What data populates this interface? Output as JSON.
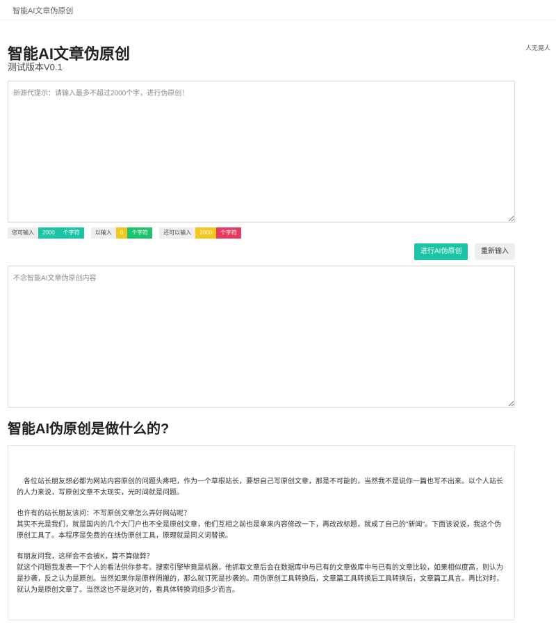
{
  "nav": {
    "brand": "智能AI文章伪原创"
  },
  "side_note": "人无竟人",
  "header": {
    "title": "智能AI文章伪原创",
    "subtitle": "测试版本V0.1"
  },
  "input": {
    "placeholder": "新源代提示：请输入最多不超过2000个字，进行伪原创！"
  },
  "counters": [
    {
      "label": "您可输入",
      "value": "2000",
      "unit": "个字符",
      "value_color": "#1bc4a4",
      "unit_color": "#1bc4a4"
    },
    {
      "label": "以输入",
      "value": "0",
      "unit": "个字符",
      "value_color": "#f5c61b",
      "unit_color": "#1bc46a"
    },
    {
      "label": "还可以输入",
      "value": "2000",
      "unit": "个字符",
      "value_color": "#f5c61b",
      "unit_color": "#e8395e"
    }
  ],
  "buttons": {
    "rewrite": "进行AI伪原创",
    "reset": "重新输入"
  },
  "output": {
    "placeholder": "不念智能AI文章伪原创内容"
  },
  "section": {
    "title": "智能AI伪原创是做什么的?",
    "paragraphs": [
      "　各位站长朋友想必都为网站内容原创的问题头疼吧，作为一个草根站长，要想自己写原创文章，那是不可能的，当然我不是说你一篇也写不出来。以个人站长的人力来说，写原创文章不太现实，光时间就是问题。",
      "也许有的站长朋友该问：不写原创文章怎么弄好网站呢？",
      "其实不光是我们，就是国内的几个大门户也不全是原创文章，他们互相之前也是拿来内容修改一下，再改改标题，就成了自己的\"新闻\"。下面该说说，我这个伪原创工具了。本程序是免费的在线伪原创工具，原理就是同义词替换。",
      "有朋友问我，这样会不会被K，算不算做弊？",
      "就这个问题我发表一下个人的看法供你参考。搜索引擎毕竟是机器，他抓取文章后会在数据库中与已有的文章做库中与已有的文章比较，如果相似度高，则认为是抄袭，反之认为是原创。当然如果你是原样照搬的，那么就订死是抄袭的。用伪原创工具转换后，文章篇工具转换后工具转换后，文章篇工具言。再比对时，就认为是原创文章了。当然这也不是绝对的，看具体转换词组多少而言。"
    ]
  },
  "colors": {
    "accent": "#1bc4a4",
    "yellow": "#f5c61b",
    "green": "#1bc46a",
    "red": "#e8395e"
  }
}
